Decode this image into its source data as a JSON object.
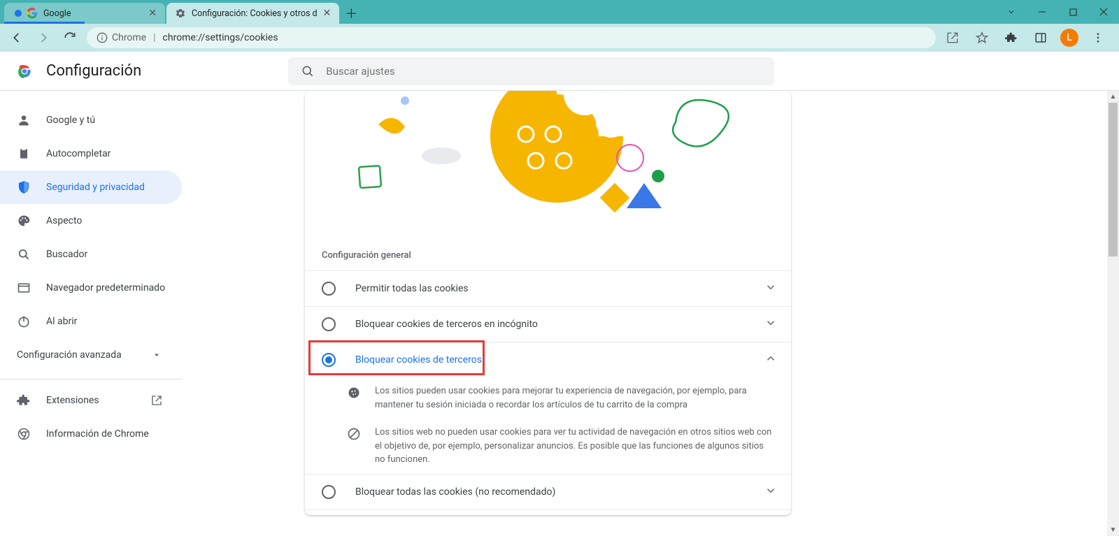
{
  "tabs": [
    {
      "title": "Google"
    },
    {
      "title": "Configuración: Cookies y otros d"
    }
  ],
  "browser": {
    "app_label": "Chrome",
    "url": "chrome://settings/cookies",
    "avatar_letter": "L"
  },
  "header": {
    "title": "Configuración",
    "search_placeholder": "Buscar ajustes"
  },
  "sidebar": {
    "items": [
      {
        "label": "Google y tú"
      },
      {
        "label": "Autocompletar"
      },
      {
        "label": "Seguridad y privacidad"
      },
      {
        "label": "Aspecto"
      },
      {
        "label": "Buscador"
      },
      {
        "label": "Navegador predeterminado"
      },
      {
        "label": "Al abrir"
      }
    ],
    "advanced": "Configuración avanzada",
    "extensions": "Extensiones",
    "about": "Información de Chrome"
  },
  "content": {
    "section_title": "Configuración general",
    "options": [
      {
        "label": "Permitir todas las cookies"
      },
      {
        "label": "Bloquear cookies de terceros en incógnito"
      },
      {
        "label": "Bloquear cookies de terceros"
      },
      {
        "label": "Bloquear todas las cookies (no recomendado)"
      }
    ],
    "desc1": "Los sitios pueden usar cookies para mejorar tu experiencia de navegación, por ejemplo, para mantener tu sesión iniciada o recordar los artículos de tu carrito de la compra",
    "desc2": "Los sitios web no pueden usar cookies para ver tu actividad de navegación en otros sitios web con el objetivo de, por ejemplo, personalizar anuncios. Es posible que las funciones de algunos sitios no funcionen."
  }
}
